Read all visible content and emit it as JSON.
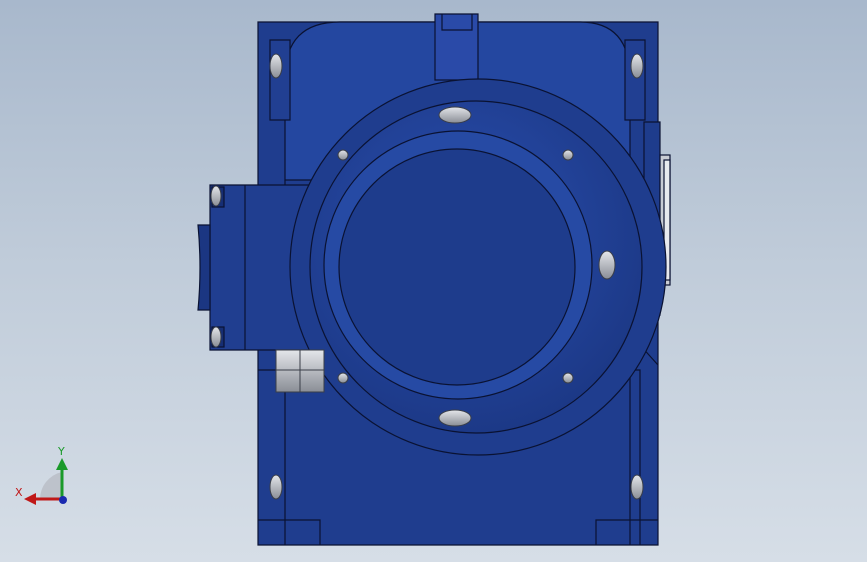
{
  "viewport": {
    "background_top": "#a8b8cc",
    "background_bottom": "#d6dee7"
  },
  "model": {
    "body_color": "#1e3c8c",
    "body_highlight": "#2a4fb0",
    "outline_color": "#0a1232",
    "bolt_color": "#b0b4bc"
  },
  "triad": {
    "x_label": "X",
    "y_label": "Y",
    "x_color": "#c01818",
    "y_color": "#1a9a2a",
    "z_color": "#1a2ab0"
  }
}
